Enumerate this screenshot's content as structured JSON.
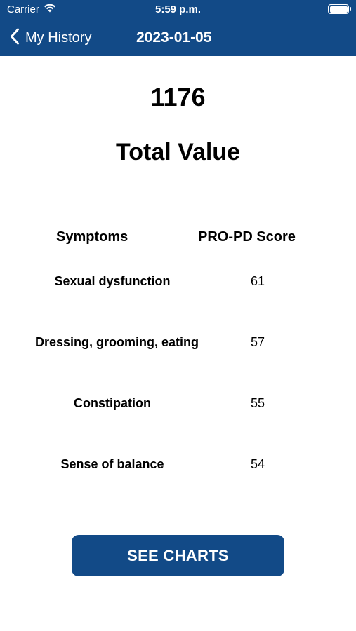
{
  "status_bar": {
    "carrier": "Carrier",
    "time": "5:59 p.m.",
    "icons": [
      "wifi-icon",
      "battery-icon"
    ]
  },
  "nav": {
    "back_label": "My History",
    "back_icon": "chevron-left-icon",
    "title": "2023-01-05"
  },
  "summary": {
    "total_value": "1176",
    "total_label": "Total Value"
  },
  "table": {
    "headers": {
      "symptoms": "Symptoms",
      "score": "PRO-PD Score"
    },
    "rows": [
      {
        "symptom": "Sexual dysfunction",
        "score": "61"
      },
      {
        "symptom": "Dressing, grooming, eating",
        "score": "57"
      },
      {
        "symptom": "Constipation",
        "score": "55"
      },
      {
        "symptom": "Sense of balance",
        "score": "54"
      }
    ]
  },
  "actions": {
    "see_charts_label": "SEE CHARTS"
  },
  "colors": {
    "primary": "#124a87",
    "divider": "#e3e3e3",
    "background": "#ffffff"
  }
}
